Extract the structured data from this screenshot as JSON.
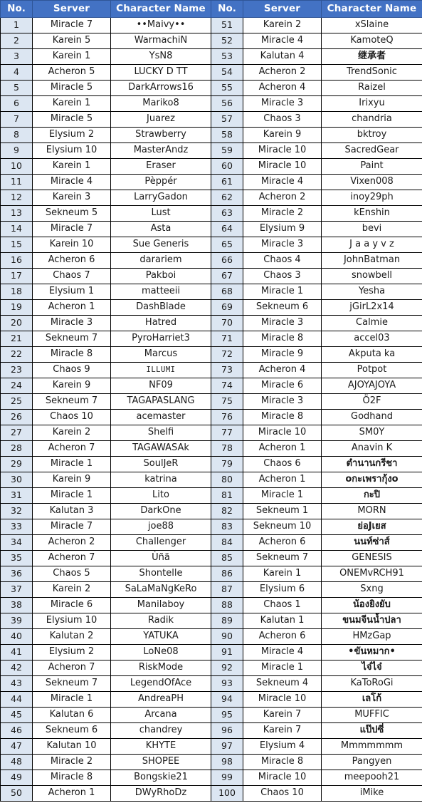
{
  "table": {
    "headers": {
      "no": "No.",
      "server": "Server",
      "character_name": "Character Name"
    },
    "colors": {
      "header_background": "#4372c4",
      "header_text": "#ffffff",
      "no_cell_background": "#dce6f2",
      "cell_border": "#000000",
      "cell_text": "#1a1a1a"
    },
    "left_rows": [
      {
        "no": "1",
        "server": "Miracle 7",
        "name": "••Maivy••"
      },
      {
        "no": "2",
        "server": "Karein 5",
        "name": "WarmachiN"
      },
      {
        "no": "3",
        "server": "Karein 1",
        "name": "YsN8"
      },
      {
        "no": "4",
        "server": "Acheron 5",
        "name": "LUCKY D TT"
      },
      {
        "no": "5",
        "server": "Miracle 5",
        "name": "DarkArrows16"
      },
      {
        "no": "6",
        "server": "Karein 1",
        "name": "Mariko8"
      },
      {
        "no": "7",
        "server": "Miracle 5",
        "name": "Juarez"
      },
      {
        "no": "8",
        "server": "Elysium 2",
        "name": "Strawberry"
      },
      {
        "no": "9",
        "server": "Elysium 10",
        "name": "MasterAndz"
      },
      {
        "no": "10",
        "server": "Karein 1",
        "name": "Eraser"
      },
      {
        "no": "11",
        "server": "Miracle 4",
        "name": "Pèppér"
      },
      {
        "no": "12",
        "server": "Karein 3",
        "name": "LarryGadon"
      },
      {
        "no": "13",
        "server": "Sekneum 5",
        "name": "Lust"
      },
      {
        "no": "14",
        "server": "Miracle 7",
        "name": "Asta"
      },
      {
        "no": "15",
        "server": "Karein 10",
        "name": "Sue Generis"
      },
      {
        "no": "16",
        "server": "Acheron 6",
        "name": "darariem"
      },
      {
        "no": "17",
        "server": "Chaos 7",
        "name": "Pakboi"
      },
      {
        "no": "18",
        "server": "Elysium 1",
        "name": "matteeii"
      },
      {
        "no": "19",
        "server": "Acheron 1",
        "name": "DashBlade"
      },
      {
        "no": "20",
        "server": "Miracle 3",
        "name": "Hatred"
      },
      {
        "no": "21",
        "server": "Sekneum 7",
        "name": "PyroHarriet3"
      },
      {
        "no": "22",
        "server": "Miracle 8",
        "name": "Marcus"
      },
      {
        "no": "23",
        "server": "Chaos 9",
        "name": "ILLUMI",
        "style": "smallcaps"
      },
      {
        "no": "24",
        "server": "Karein 9",
        "name": "NF09"
      },
      {
        "no": "25",
        "server": "Sekneum 7",
        "name": "TAGAPASLANG"
      },
      {
        "no": "26",
        "server": "Chaos 10",
        "name": "acemaster"
      },
      {
        "no": "27",
        "server": "Karein 2",
        "name": "Shelfi"
      },
      {
        "no": "28",
        "server": "Acheron 7",
        "name": "TAGAWASAk"
      },
      {
        "no": "29",
        "server": "Miracle 1",
        "name": "SoulJeR"
      },
      {
        "no": "30",
        "server": "Karein 9",
        "name": "katrina"
      },
      {
        "no": "31",
        "server": "Miracle 1",
        "name": "Lito"
      },
      {
        "no": "32",
        "server": "Kalutan 3",
        "name": "DarkOne"
      },
      {
        "no": "33",
        "server": "Miracle 7",
        "name": "joe88"
      },
      {
        "no": "34",
        "server": "Acheron 2",
        "name": "Challenger"
      },
      {
        "no": "35",
        "server": "Acheron 7",
        "name": "Ùñä"
      },
      {
        "no": "36",
        "server": "Chaos 5",
        "name": "Shontelle"
      },
      {
        "no": "37",
        "server": "Karein 2",
        "name": "SaLaMaNgKeRo"
      },
      {
        "no": "38",
        "server": "Miracle 6",
        "name": "Manilaboy"
      },
      {
        "no": "39",
        "server": "Elysium 10",
        "name": "Radik"
      },
      {
        "no": "40",
        "server": "Kalutan 2",
        "name": "YATUKA"
      },
      {
        "no": "41",
        "server": "Elysium 2",
        "name": "LoNe08"
      },
      {
        "no": "42",
        "server": "Acheron 7",
        "name": "RiskMode"
      },
      {
        "no": "43",
        "server": "Sekneum 7",
        "name": "LegendOfAce"
      },
      {
        "no": "44",
        "server": "Miracle 1",
        "name": "AndreaPH"
      },
      {
        "no": "45",
        "server": "Kalutan 6",
        "name": "Arcana"
      },
      {
        "no": "46",
        "server": "Sekneum 6",
        "name": "chandrey"
      },
      {
        "no": "47",
        "server": "Kalutan 10",
        "name": "KHYTE"
      },
      {
        "no": "48",
        "server": "Miracle 2",
        "name": "SHOPEE"
      },
      {
        "no": "49",
        "server": "Miracle 8",
        "name": "Bongskie21"
      },
      {
        "no": "50",
        "server": "Acheron 1",
        "name": "DWyRhoDz"
      }
    ],
    "right_rows": [
      {
        "no": "51",
        "server": "Karein 2",
        "name": "xSlaine"
      },
      {
        "no": "52",
        "server": "Miracle 4",
        "name": "KamoteQ"
      },
      {
        "no": "53",
        "server": "Kalutan 4",
        "name": "继承者",
        "style": "cjk"
      },
      {
        "no": "54",
        "server": "Acheron 2",
        "name": "TrendSonic"
      },
      {
        "no": "55",
        "server": "Acheron 4",
        "name": "Raizel"
      },
      {
        "no": "56",
        "server": "Miracle 3",
        "name": "Irixyu"
      },
      {
        "no": "57",
        "server": "Chaos 3",
        "name": "chandria"
      },
      {
        "no": "58",
        "server": "Karein 9",
        "name": "bktroy"
      },
      {
        "no": "59",
        "server": "Miracle 10",
        "name": "SacredGear"
      },
      {
        "no": "60",
        "server": "Miracle 10",
        "name": "Paint"
      },
      {
        "no": "61",
        "server": "Miracle 4",
        "name": "Vixen008"
      },
      {
        "no": "62",
        "server": "Acheron 2",
        "name": "inoy29ph"
      },
      {
        "no": "63",
        "server": "Miracle 2",
        "name": "kEnshin"
      },
      {
        "no": "64",
        "server": "Elysium 9",
        "name": "bevi"
      },
      {
        "no": "65",
        "server": "Miracle 3",
        "name": "J a a y v z"
      },
      {
        "no": "66",
        "server": "Chaos 4",
        "name": "JohnBatman"
      },
      {
        "no": "67",
        "server": "Chaos 3",
        "name": "snowbell"
      },
      {
        "no": "68",
        "server": "Miracle 1",
        "name": "Yesha"
      },
      {
        "no": "69",
        "server": "Sekneum 6",
        "name": "jGirL2x14"
      },
      {
        "no": "70",
        "server": "Miracle 3",
        "name": "Calmie"
      },
      {
        "no": "71",
        "server": "Miracle 8",
        "name": "accel03"
      },
      {
        "no": "72",
        "server": "Miracle 9",
        "name": "Akputa ka"
      },
      {
        "no": "73",
        "server": "Acheron 4",
        "name": "Potpot"
      },
      {
        "no": "74",
        "server": "Miracle 6",
        "name": "AJOYAJOYA"
      },
      {
        "no": "75",
        "server": "Miracle 3",
        "name": "Ö2F"
      },
      {
        "no": "76",
        "server": "Miracle 8",
        "name": "Godhand"
      },
      {
        "no": "77",
        "server": "Miracle 10",
        "name": "SM0Y"
      },
      {
        "no": "78",
        "server": "Acheron 1",
        "name": "Anavin K"
      },
      {
        "no": "79",
        "server": "Chaos 6",
        "name": "ตำนานกรีชา",
        "style": "thai"
      },
      {
        "no": "80",
        "server": "Acheron 1",
        "name": "oกะเพรากุ้งo",
        "style": "thai"
      },
      {
        "no": "81",
        "server": "Miracle 1",
        "name": "กะปิ",
        "style": "thai"
      },
      {
        "no": "82",
        "server": "Sekneum 1",
        "name": "MORN"
      },
      {
        "no": "83",
        "server": "Sekneum 10",
        "name": "ย่อJเยส",
        "style": "thai"
      },
      {
        "no": "84",
        "server": "Acheron 6",
        "name": "นนท์ซ่าส์",
        "style": "thai"
      },
      {
        "no": "85",
        "server": "Sekneum 7",
        "name": "GENESIS"
      },
      {
        "no": "86",
        "server": "Karein 1",
        "name": "ONEMvRCH91"
      },
      {
        "no": "87",
        "server": "Elysium 6",
        "name": "Sxng"
      },
      {
        "no": "88",
        "server": "Chaos 1",
        "name": "น้องยิงยับ",
        "style": "thai"
      },
      {
        "no": "89",
        "server": "Kalutan 1",
        "name": "ขนมจีนน้ำปลา",
        "style": "thai"
      },
      {
        "no": "90",
        "server": "Acheron 6",
        "name": "HMzGap"
      },
      {
        "no": "91",
        "server": "Miracle 4",
        "name": "•ขันหมาก•",
        "style": "thai"
      },
      {
        "no": "92",
        "server": "Miracle 1",
        "name": "ไจ๋ไจ๋",
        "style": "thai"
      },
      {
        "no": "93",
        "server": "Sekneum 4",
        "name": "KaToRoGi"
      },
      {
        "no": "94",
        "server": "Miracle 10",
        "name": "เลโก้",
        "style": "thai"
      },
      {
        "no": "95",
        "server": "Karein 7",
        "name": "MUFFIC"
      },
      {
        "no": "96",
        "server": "Karein 7",
        "name": "แป๊ปซี่",
        "style": "thai"
      },
      {
        "no": "97",
        "server": "Elysium 4",
        "name": "Mmmmmmm"
      },
      {
        "no": "98",
        "server": "Miracle 8",
        "name": "Pangyen"
      },
      {
        "no": "99",
        "server": "Miracle 10",
        "name": "meepooh21"
      },
      {
        "no": "100",
        "server": "Chaos 10",
        "name": "iMike"
      }
    ]
  }
}
